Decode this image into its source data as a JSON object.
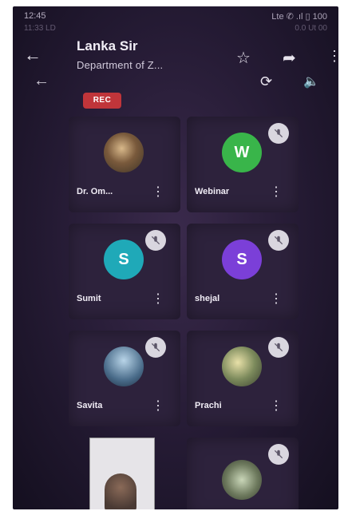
{
  "status_bar": {
    "time": "12:45",
    "right_text": "Lte ✆ .ıl ▯ 100",
    "ghost_left": "11:33 LD",
    "ghost_right": "0.0 Ut 00"
  },
  "header": {
    "title": "Lanka Sir",
    "subtitle": "Department of Z...",
    "rec_label": "REC"
  },
  "participants": [
    {
      "name": "Dr. Om...",
      "avatar_letter": "",
      "avatar_color": "#8c6a48",
      "muted": false
    },
    {
      "name": "Webinar",
      "avatar_letter": "W",
      "avatar_color": "#39b54a",
      "muted": true
    },
    {
      "name": "Sumit",
      "avatar_letter": "S",
      "avatar_color": "#1fa9b8",
      "muted": true
    },
    {
      "name": "shejal",
      "avatar_letter": "S",
      "avatar_color": "#7b3fd8",
      "muted": true
    },
    {
      "name": "Savita",
      "avatar_letter": "",
      "avatar_color": "#4a6c8a",
      "muted": true
    },
    {
      "name": "Prachi",
      "avatar_letter": "",
      "avatar_color": "#7c8a5c",
      "muted": true
    },
    {
      "name": "",
      "avatar_letter": "",
      "avatar_color": "#6e7a5e",
      "muted": true
    }
  ],
  "icons": [
    "back-arrow-icon",
    "star-icon",
    "share-icon",
    "more-vert-icon",
    "rotate-camera-icon",
    "speaker-icon",
    "mic-off-icon"
  ]
}
